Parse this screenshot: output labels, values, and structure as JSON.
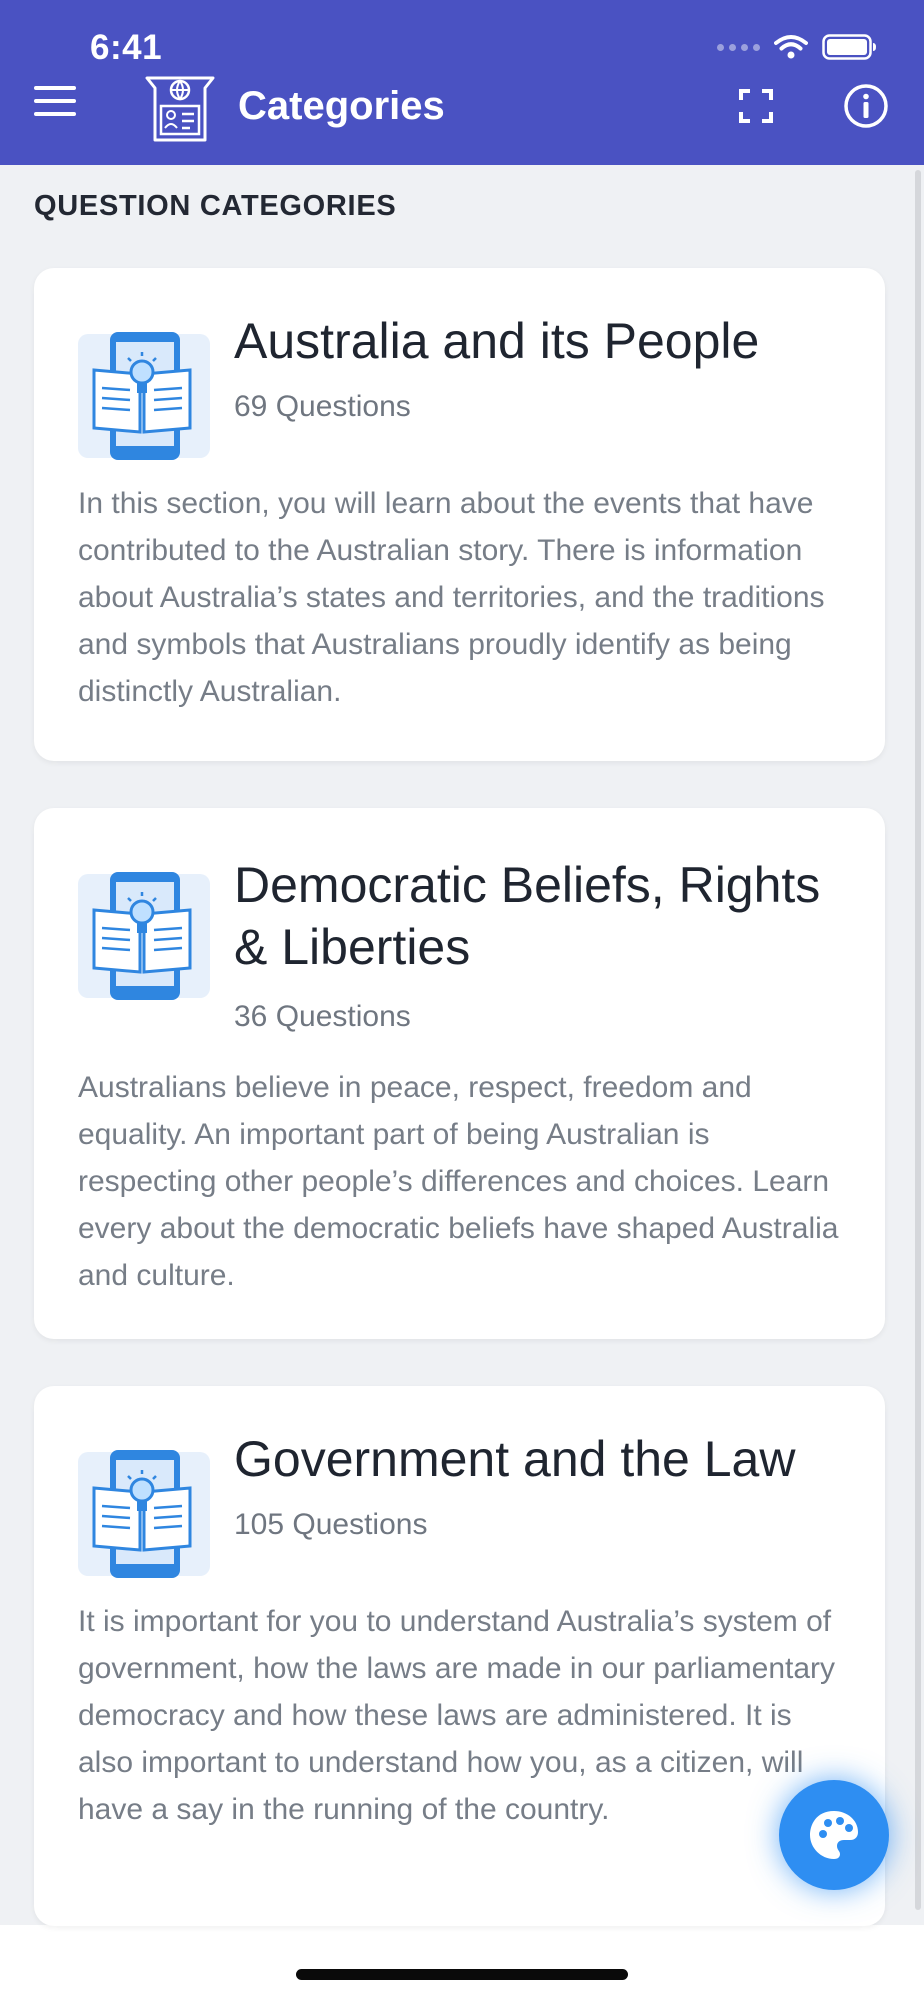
{
  "status_bar": {
    "time": "6:41"
  },
  "app_bar": {
    "title": "Categories"
  },
  "section": {
    "header": "QUESTION CATEGORIES"
  },
  "categories": [
    {
      "title": "Australia and its People",
      "count": "69 Questions",
      "description": "In this section, you will learn about the events that have contributed to the Australian story. There is information about Australia’s states and territories, and the traditions and symbols that Australians proudly identify as being distinctly Australian."
    },
    {
      "title": "Democratic Beliefs, Rights & Liberties",
      "count": "36 Questions",
      "description": "Australians believe in peace, respect, freedom and equality. An important part of being Australian is respecting other people’s differences and choices. Learn every about the democratic beliefs have shaped Australia and culture."
    },
    {
      "title": "Government and the Law",
      "count": "105 Questions",
      "description": "It is important for you to understand Australia’s system of government, how the laws are made in our parliamentary democracy and how these laws are administered. It is also important to understand how you, as a citizen, will have a say in the running of the country."
    }
  ],
  "icons": {
    "menu": "menu-icon",
    "logo": "citizenship-logo-icon",
    "expand": "fullscreen-icon",
    "info": "info-icon",
    "category": "book-idea-icon",
    "fab": "palette-icon"
  },
  "colors": {
    "app_bar": "#4a52c2",
    "background": "#eff1f4",
    "fab": "#2e8ef2"
  }
}
